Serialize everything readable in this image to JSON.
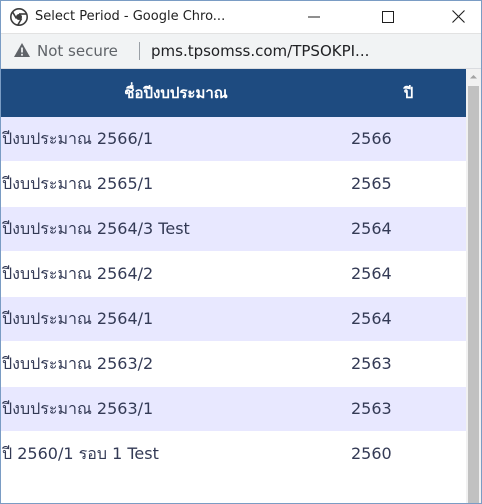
{
  "window": {
    "title": "Select Period - Google Chro..."
  },
  "addressbar": {
    "security_label": "Not secure",
    "url": "pms.tpsomss.com/TPSOKPI..."
  },
  "table": {
    "headers": {
      "name": "ชื่อปีงบประมาณ",
      "year": "ปี"
    },
    "rows": [
      {
        "name": "ปีงบประมาณ 2566/1",
        "year": "2566"
      },
      {
        "name": "ปีงบประมาณ 2565/1",
        "year": "2565"
      },
      {
        "name": "ปีงบประมาณ 2564/3 Test",
        "year": "2564"
      },
      {
        "name": "ปีงบประมาณ 2564/2",
        "year": "2564"
      },
      {
        "name": "ปีงบประมาณ 2564/1",
        "year": "2564"
      },
      {
        "name": "ปีงบประมาณ 2563/2",
        "year": "2563"
      },
      {
        "name": "ปีงบประมาณ 2563/1",
        "year": "2563"
      },
      {
        "name": "ปี 2560/1 รอบ 1 Test",
        "year": "2560"
      }
    ]
  },
  "icons": {
    "browser": "chrome-icon",
    "minimize": "minimize-icon",
    "maximize": "maximize-icon",
    "close": "close-icon",
    "security": "warning-triangle-icon"
  },
  "colors": {
    "header_bg": "#1e4b80",
    "header_text": "#ffffff",
    "row_alt_bg": "#e8e8ff",
    "row_text": "#333a55"
  }
}
